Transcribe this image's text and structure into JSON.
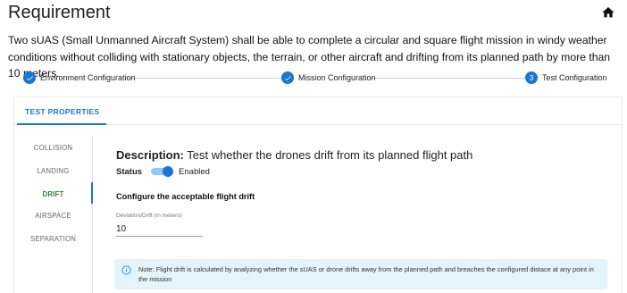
{
  "header": {
    "title": "Requirement",
    "requirement_text": "Two sUAS (Small Unmanned Aircraft System) shall be able to complete a circular and square flight mission in windy weather conditions without colliding with stationary objects, the terrain, or other aircraft and drifting from its planned path by more than 10 meters."
  },
  "stepper": {
    "steps": [
      {
        "label": "Environment Configuration",
        "state": "completed",
        "icon": "check-icon"
      },
      {
        "label": "Mission Configuration",
        "state": "completed",
        "icon": "check-icon"
      },
      {
        "label": "Test Configuration",
        "state": "active",
        "number": "3"
      }
    ]
  },
  "tabs": [
    {
      "label": "TEST PROPERTIES",
      "active": true
    }
  ],
  "side_nav": {
    "items": [
      {
        "label": "COLLISION",
        "active": false
      },
      {
        "label": "LANDING",
        "active": false
      },
      {
        "label": "DRIFT",
        "active": true
      },
      {
        "label": "AIRSPACE",
        "active": false
      },
      {
        "label": "SEPARATION",
        "active": false
      }
    ]
  },
  "panel": {
    "description_label": "Description:",
    "description_text": "Test whether the drones drift from its planned flight path",
    "status_label": "Status",
    "status_value": "Enabled",
    "status_enabled": true,
    "section_title": "Configure the acceptable flight drift",
    "field_label": "Deviation/Drift (in meters)",
    "field_value": "10",
    "note": "Note: Flight drift is calculated by analyzing whether the sUAS or drone drifts away from the planned path and breaches the configured distace at any point in the mission"
  },
  "colors": {
    "accent": "#1976d2",
    "active_nav": "#2e7d32",
    "note_bg": "#e5f4fb"
  }
}
